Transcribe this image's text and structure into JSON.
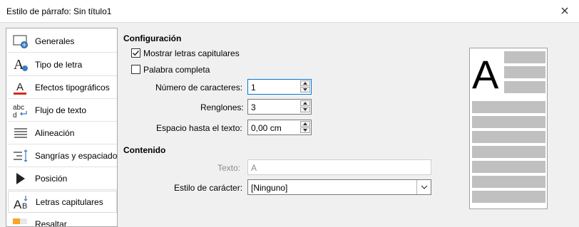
{
  "window": {
    "title": "Estilo de párrafo: Sin título1"
  },
  "sidebar": {
    "items": [
      {
        "label": "Generales",
        "icon": "general-icon"
      },
      {
        "label": "Tipo de letra",
        "icon": "font-icon"
      },
      {
        "label": "Efectos tipográficos",
        "icon": "font-effects-icon"
      },
      {
        "label": "Flujo de texto",
        "icon": "text-flow-icon"
      },
      {
        "label": "Alineación",
        "icon": "align-icon"
      },
      {
        "label": "Sangrías y espaciado",
        "icon": "indent-icon"
      },
      {
        "label": "Posición",
        "icon": "position-icon"
      },
      {
        "label": "Letras capitulares",
        "icon": "drop-caps-icon",
        "selected": true
      },
      {
        "label": "Resaltar",
        "icon": "highlight-icon"
      }
    ]
  },
  "config": {
    "heading": "Configuración",
    "show_drop_caps": {
      "label": "Mostrar letras capitulares",
      "checked": true
    },
    "whole_word": {
      "label": "Palabra completa",
      "checked": false
    },
    "num_chars": {
      "label": "Número de caracteres:",
      "value": "1"
    },
    "lines": {
      "label": "Renglones:",
      "value": "3"
    },
    "space_to_text": {
      "label": "Espacio hasta el texto:",
      "value": "0,00 cm"
    }
  },
  "contents": {
    "heading": "Contenido",
    "text": {
      "label": "Texto:",
      "value": "A"
    },
    "char_style": {
      "label": "Estilo de carácter:",
      "value": "[Ninguno]"
    }
  },
  "preview": {
    "drop_letter": "A"
  },
  "colors": {
    "accent": "#0078d7",
    "preview_line": "#c0c0c0"
  }
}
